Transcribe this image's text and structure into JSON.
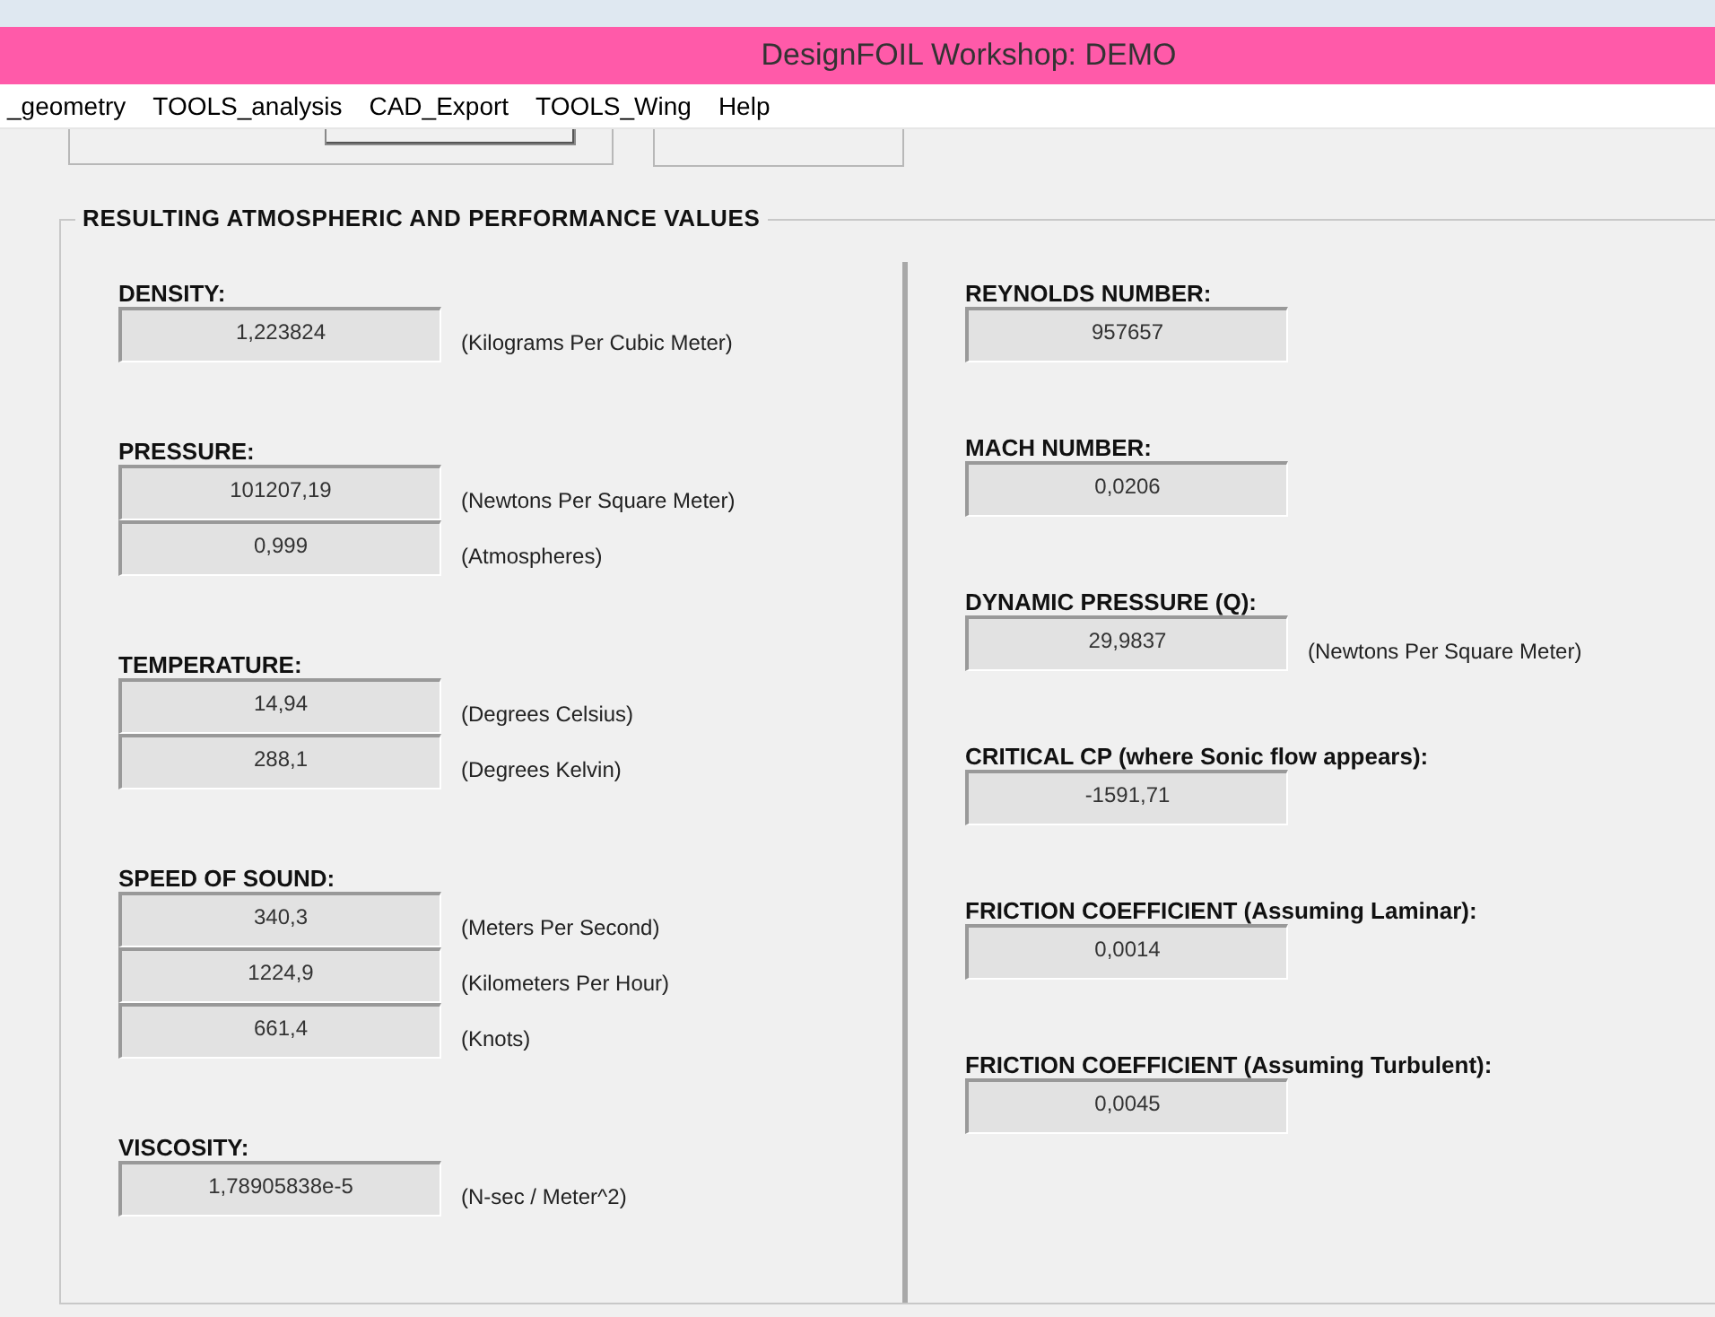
{
  "window": {
    "title": "DesignFOIL Workshop: DEMO"
  },
  "menu": [
    "_geometry",
    "TOOLS_analysis",
    "CAD_Export",
    "TOOLS_Wing",
    "Help"
  ],
  "group": {
    "title": "RESULTING ATMOSPHERIC AND PERFORMANCE VALUES"
  },
  "left_sections": [
    {
      "label": "DENSITY:",
      "fields": [
        {
          "value": "1,223824",
          "unit": "(Kilograms Per Cubic Meter)"
        }
      ]
    },
    {
      "label": "PRESSURE:",
      "fields": [
        {
          "value": "101207,19",
          "unit": "(Newtons Per Square Meter)"
        },
        {
          "value": "0,999",
          "unit": "(Atmospheres)"
        }
      ]
    },
    {
      "label": "TEMPERATURE:",
      "fields": [
        {
          "value": "14,94",
          "unit": "(Degrees Celsius)"
        },
        {
          "value": "288,1",
          "unit": "(Degrees Kelvin)"
        }
      ]
    },
    {
      "label": "SPEED OF SOUND:",
      "fields": [
        {
          "value": "340,3",
          "unit": "(Meters Per Second)"
        },
        {
          "value": "1224,9",
          "unit": "(Kilometers Per Hour)"
        },
        {
          "value": "661,4",
          "unit": "(Knots)"
        }
      ]
    },
    {
      "label": "VISCOSITY:",
      "fields": [
        {
          "value": "1,78905838e-5",
          "unit": "(N-sec / Meter^2)"
        }
      ]
    }
  ],
  "right_sections": [
    {
      "label": "REYNOLDS NUMBER:",
      "fields": [
        {
          "value": "957657"
        }
      ]
    },
    {
      "label": "MACH NUMBER:",
      "fields": [
        {
          "value": "0,0206"
        }
      ]
    },
    {
      "label": "DYNAMIC PRESSURE (Q):",
      "fields": [
        {
          "value": "29,9837",
          "unit": "(Newtons Per Square Meter)"
        }
      ]
    },
    {
      "label": "CRITICAL CP (where Sonic flow appears):",
      "fields": [
        {
          "value": "-1591,71"
        }
      ]
    },
    {
      "label": "FRICTION COEFFICIENT (Assuming Laminar):",
      "fields": [
        {
          "value": "0,0014"
        }
      ]
    },
    {
      "label": "FRICTION COEFFICIENT (Assuming Turbulent):",
      "fields": [
        {
          "value": "0,0045"
        }
      ]
    }
  ]
}
